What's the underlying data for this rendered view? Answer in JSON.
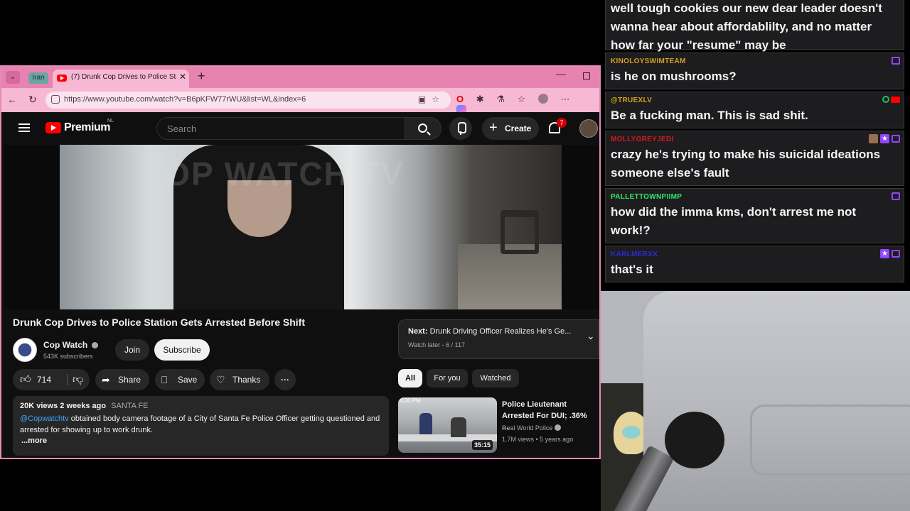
{
  "browser": {
    "tab_group_label": "Iran",
    "tab_title": "(7) Drunk Cop Drives to Police Stat",
    "url": "https://www.youtube.com/watch?v=B6pKFW77rWU&list=WL&index=6"
  },
  "youtube": {
    "logo_text": "Premium",
    "region": "NL",
    "search_placeholder": "Search",
    "create_label": "Create",
    "notification_count": "7",
    "player": {
      "watermark": "COP WATCH TV"
    },
    "video": {
      "title": "Drunk Cop Drives to Police Station Gets Arrested Before Shift",
      "channel_name": "Cop Watch",
      "subscribers": "543K subscribers",
      "join_label": "Join",
      "subscribe_label": "Subscribe",
      "likes": "714",
      "share_label": "Share",
      "save_label": "Save",
      "thanks_label": "Thanks",
      "more_label": "···"
    },
    "description": {
      "views": "20K views",
      "age": "2 weeks ago",
      "location": "SANTA FE",
      "handle": "@Copwatchtv",
      "body": " obtained body camera footage of a City of Santa Fe Police Officer getting questioned and arrested for showing up to work drunk.",
      "more": "...more"
    },
    "playlist": {
      "next_label": "Next:",
      "next_title": "Drunk Driving Officer Realizes He's Ge...",
      "sub": "Watch later - 6 / 117"
    },
    "chips": [
      "All",
      "For you",
      "Watched"
    ],
    "recommendation": {
      "title": "Police Lieutenant Arrested For DUI; .36% ...",
      "channel": "Real World Police",
      "stats": "1.7M views • 5 years ago",
      "duration": "35:15",
      "timestamp": "4:20 PM"
    }
  },
  "chat": {
    "first_message_text": "well tough cookies our new dear leader doesn't wanna hear about affordablilty, and no matter how far your \"resume\" may be",
    "messages": [
      {
        "user": "KINOLOYSWIMTEAM",
        "user_color": "#d4a01e",
        "text": "is he on mushrooms?"
      },
      {
        "user": "@TRUEXLV",
        "user_color": "#d4a01e",
        "text": "Be a fucking man. This is sad shit."
      },
      {
        "user": "MOLLYGREYJEDI",
        "user_color": "#d41a1a",
        "text": "crazy he's trying to make his suicidal ideations someone else's fault"
      },
      {
        "user": "PALLETTOWNPIIMP",
        "user_color": "#2ee86a",
        "text": "how did the imma kms, don't arrest me not work!?"
      },
      {
        "user": "KARLMERXX",
        "user_color": "#2a2ad4",
        "text": "that's it"
      }
    ]
  }
}
